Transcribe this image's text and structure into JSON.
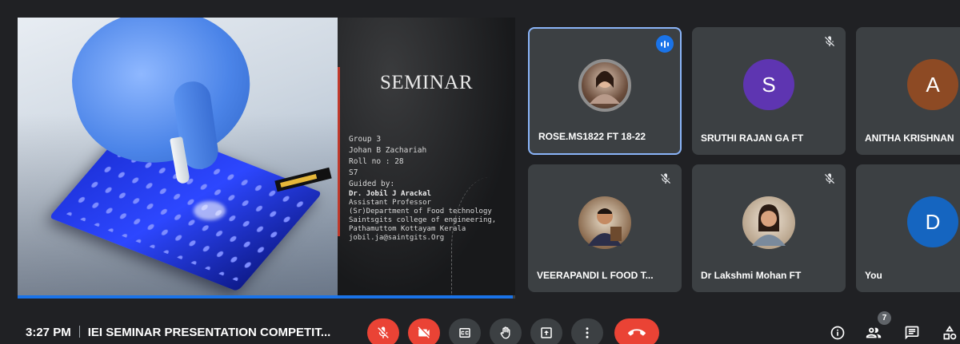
{
  "slide": {
    "title": "SEMINAR",
    "lines": [
      "Group 3",
      "Johan B Zachariah",
      "Roll no : 28",
      "S7",
      "Guided by:"
    ],
    "guide_name": "Dr. Jobil J Arackal",
    "guide_details": [
      "Assistant Professor",
      "(Sr)Department of Food technology",
      "Saintsgits college of engineering,",
      "Pathamuttom Kottayam Kerala",
      "jobil.ja@saintgits.Org"
    ],
    "progress": 0.995
  },
  "participants": [
    {
      "name": "ROSE.MS1822 FT 18-22",
      "avatar_type": "photo",
      "speaking": true,
      "muted": false
    },
    {
      "name": "SRUTHI RAJAN GA FT",
      "avatar_type": "initial",
      "initial": "S",
      "color": "#5e35b1",
      "muted": true
    },
    {
      "name": "ANITHA KRISHNAN",
      "avatar_type": "initial",
      "initial": "A",
      "color": "#8d4a24",
      "muted": false
    },
    {
      "name": "VEERAPANDI L FOOD T...",
      "avatar_type": "photo",
      "muted": true
    },
    {
      "name": "Dr Lakshmi Mohan FT",
      "avatar_type": "photo",
      "muted": true
    },
    {
      "name": "You",
      "avatar_type": "initial",
      "initial": "D",
      "color": "#1565c0",
      "muted": false
    }
  ],
  "bottom_bar": {
    "time": "3:27 PM",
    "meeting_title": "IEI SEMINAR PRESENTATION COMPETIT...",
    "controls": [
      "mic-off-icon",
      "camera-off-icon",
      "captions-icon",
      "raise-hand-icon",
      "present-icon",
      "more-options-icon",
      "end-call-icon"
    ],
    "people_count": "7",
    "right_icons": [
      "info-icon",
      "people-icon",
      "chat-icon",
      "activities-icon"
    ]
  }
}
